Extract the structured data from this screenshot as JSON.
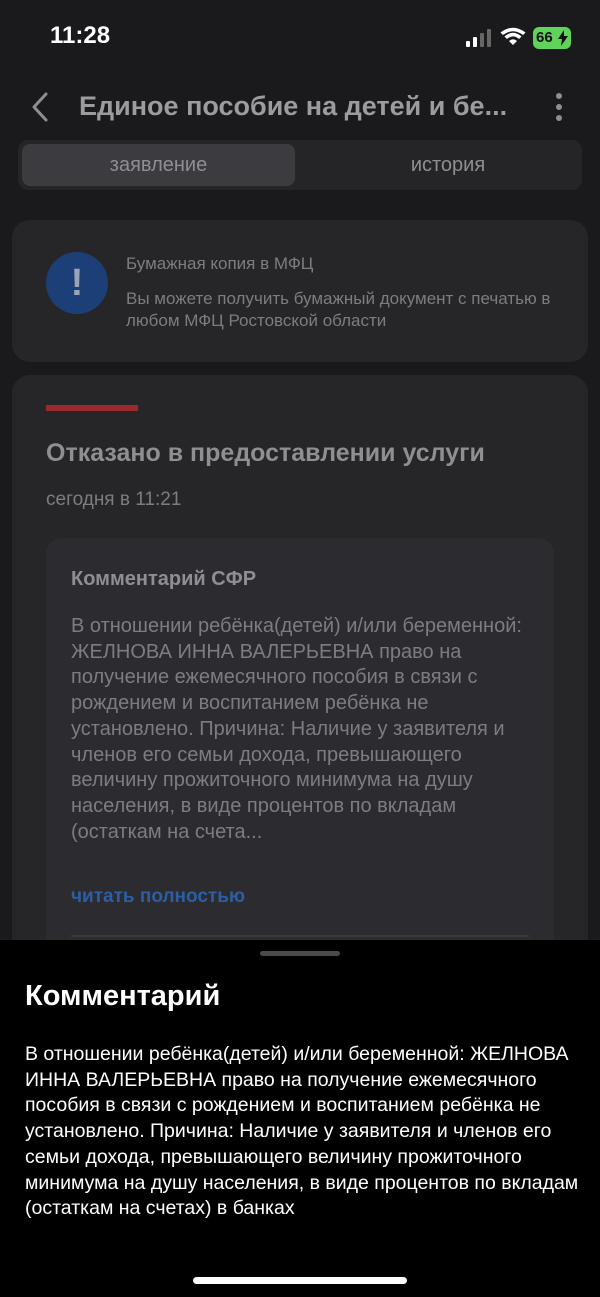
{
  "status_bar": {
    "time": "11:28",
    "battery": "66"
  },
  "nav": {
    "title": "Единое пособие на детей и бе..."
  },
  "tabs": [
    {
      "label": "заявление",
      "active": true
    },
    {
      "label": "история",
      "active": false
    }
  ],
  "info_card": {
    "title": "Бумажная копия в МФЦ",
    "text": "Вы можете получить бумажный документ с печатью в любом МФЦ Ростовской области",
    "icon": "exclamation-icon"
  },
  "status_card": {
    "title": "Отказано в предоставлении услуги",
    "date": "сегодня в 11:21",
    "comment_title": "Комментарий СФР",
    "comment_text": "В отношении ребёнка(детей) и/или беременной: ЖЕЛНОВА ИННА ВАЛЕРЬЕВНА право на получение ежемесячного пособия в связи с рождением и воспитанием ребёнка не установлено. Причина: Наличие у заявителя и членов его семьи дохода, превышающего величину прожиточного минимума на душу населения, в виде процентов по вкладам (остаткам на счета...",
    "read_more": "читать полностью"
  },
  "sheet": {
    "title": "Комментарий",
    "text": "В отношении ребёнка(детей) и/или беременной: ЖЕЛНОВА ИННА ВАЛЕРЬЕВНА право на получение ежемесячного пособия в связи с рождением и воспитанием ребёнка не установлено. Причина: Наличие у заявителя и членов его семьи дохода, превышающего величину прожиточного минимума на душу населения, в виде процентов по вкладам (остаткам на счетах) в банках"
  },
  "colors": {
    "accent_blue": "#2d5ea3",
    "error_red": "#9a2a2c",
    "battery_green": "#5fd35a"
  }
}
